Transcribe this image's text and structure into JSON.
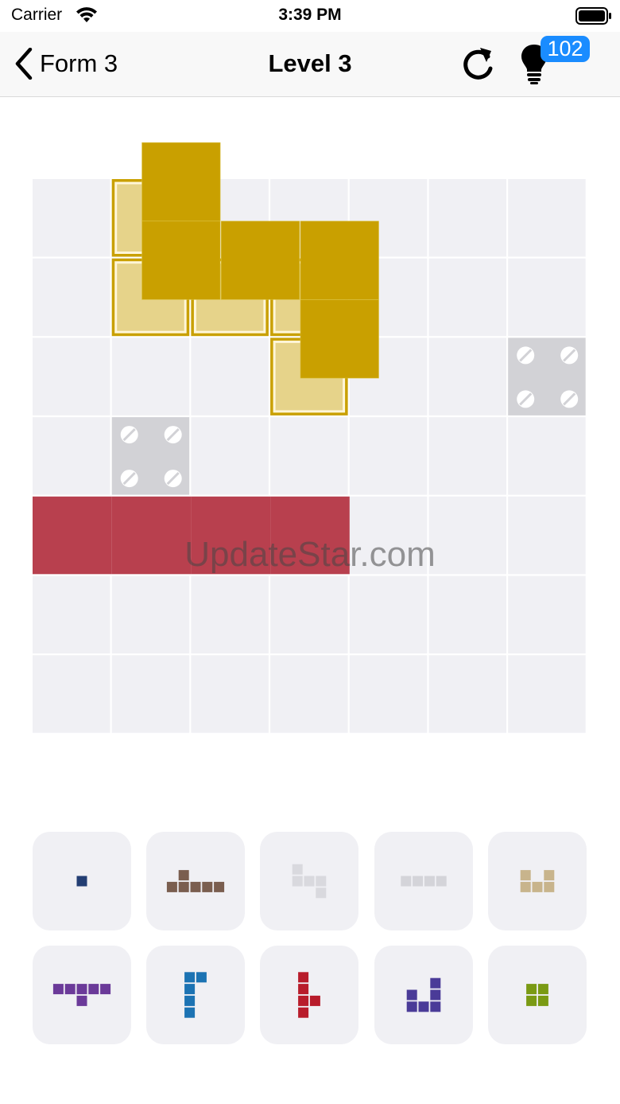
{
  "status_bar": {
    "carrier": "Carrier",
    "time": "3:39 PM"
  },
  "nav": {
    "back_label": "Form 3",
    "title": "Level 3",
    "hint_count": "102",
    "icons": [
      "chevron-left-icon",
      "restart-icon",
      "lightbulb-icon"
    ]
  },
  "board": {
    "rows": 7,
    "cols": 7,
    "blocked_cells": [
      [
        2,
        6
      ],
      [
        3,
        1
      ]
    ],
    "target_piece": {
      "color": "#c9a000",
      "outline_color": "#e6d38a",
      "outline_cells": [
        [
          0,
          1
        ],
        [
          1,
          1
        ],
        [
          1,
          2
        ],
        [
          1,
          3
        ],
        [
          2,
          3
        ]
      ],
      "floating_cells": [
        [
          -0.46,
          1.38
        ],
        [
          0.53,
          1.38
        ],
        [
          0.53,
          2.38
        ],
        [
          0.53,
          3.38
        ],
        [
          1.52,
          3.38
        ]
      ]
    },
    "placed_pieces": [
      {
        "color": "#b8404e",
        "cells": [
          [
            4,
            0
          ],
          [
            4,
            1
          ],
          [
            4,
            2
          ],
          [
            4,
            3
          ]
        ]
      }
    ],
    "empty_color": "#f0f0f4",
    "blocked_color": "#d2d2d6"
  },
  "watermark": "UpdateStar.com",
  "tray": {
    "pieces": [
      {
        "color": "#233e73",
        "cells": [
          [
            0,
            0
          ]
        ]
      },
      {
        "color": "#7a5e4f",
        "cells": [
          [
            0,
            1
          ],
          [
            1,
            0
          ],
          [
            1,
            1
          ],
          [
            1,
            2
          ],
          [
            1,
            3
          ],
          [
            1,
            4
          ]
        ]
      },
      {
        "color": "#d9d9de",
        "cells": [
          [
            0,
            0
          ],
          [
            1,
            0
          ],
          [
            1,
            1
          ],
          [
            1,
            2
          ],
          [
            2,
            2
          ]
        ]
      },
      {
        "color": "#d4d4d9",
        "cells": [
          [
            0,
            0
          ],
          [
            0,
            1
          ],
          [
            0,
            2
          ],
          [
            0,
            3
          ]
        ]
      },
      {
        "color": "#c8b48c",
        "cells": [
          [
            0,
            0
          ],
          [
            0,
            2
          ],
          [
            1,
            0
          ],
          [
            1,
            1
          ],
          [
            1,
            2
          ]
        ]
      },
      {
        "color": "#6b3a99",
        "cells": [
          [
            0,
            0
          ],
          [
            0,
            1
          ],
          [
            0,
            2
          ],
          [
            0,
            3
          ],
          [
            0,
            4
          ],
          [
            1,
            2
          ]
        ]
      },
      {
        "color": "#1c73b3",
        "cells": [
          [
            0,
            0
          ],
          [
            0,
            1
          ],
          [
            1,
            0
          ],
          [
            2,
            0
          ],
          [
            3,
            0
          ]
        ]
      },
      {
        "color": "#b81c2b",
        "cells": [
          [
            0,
            0
          ],
          [
            1,
            0
          ],
          [
            2,
            0
          ],
          [
            2,
            1
          ],
          [
            3,
            0
          ]
        ]
      },
      {
        "color": "#4a3b98",
        "cells": [
          [
            0,
            2
          ],
          [
            1,
            0
          ],
          [
            1,
            2
          ],
          [
            2,
            0
          ],
          [
            2,
            1
          ],
          [
            2,
            2
          ]
        ]
      },
      {
        "color": "#7a9a14",
        "cells": [
          [
            0,
            0
          ],
          [
            0,
            1
          ],
          [
            1,
            0
          ],
          [
            1,
            1
          ]
        ]
      }
    ]
  }
}
